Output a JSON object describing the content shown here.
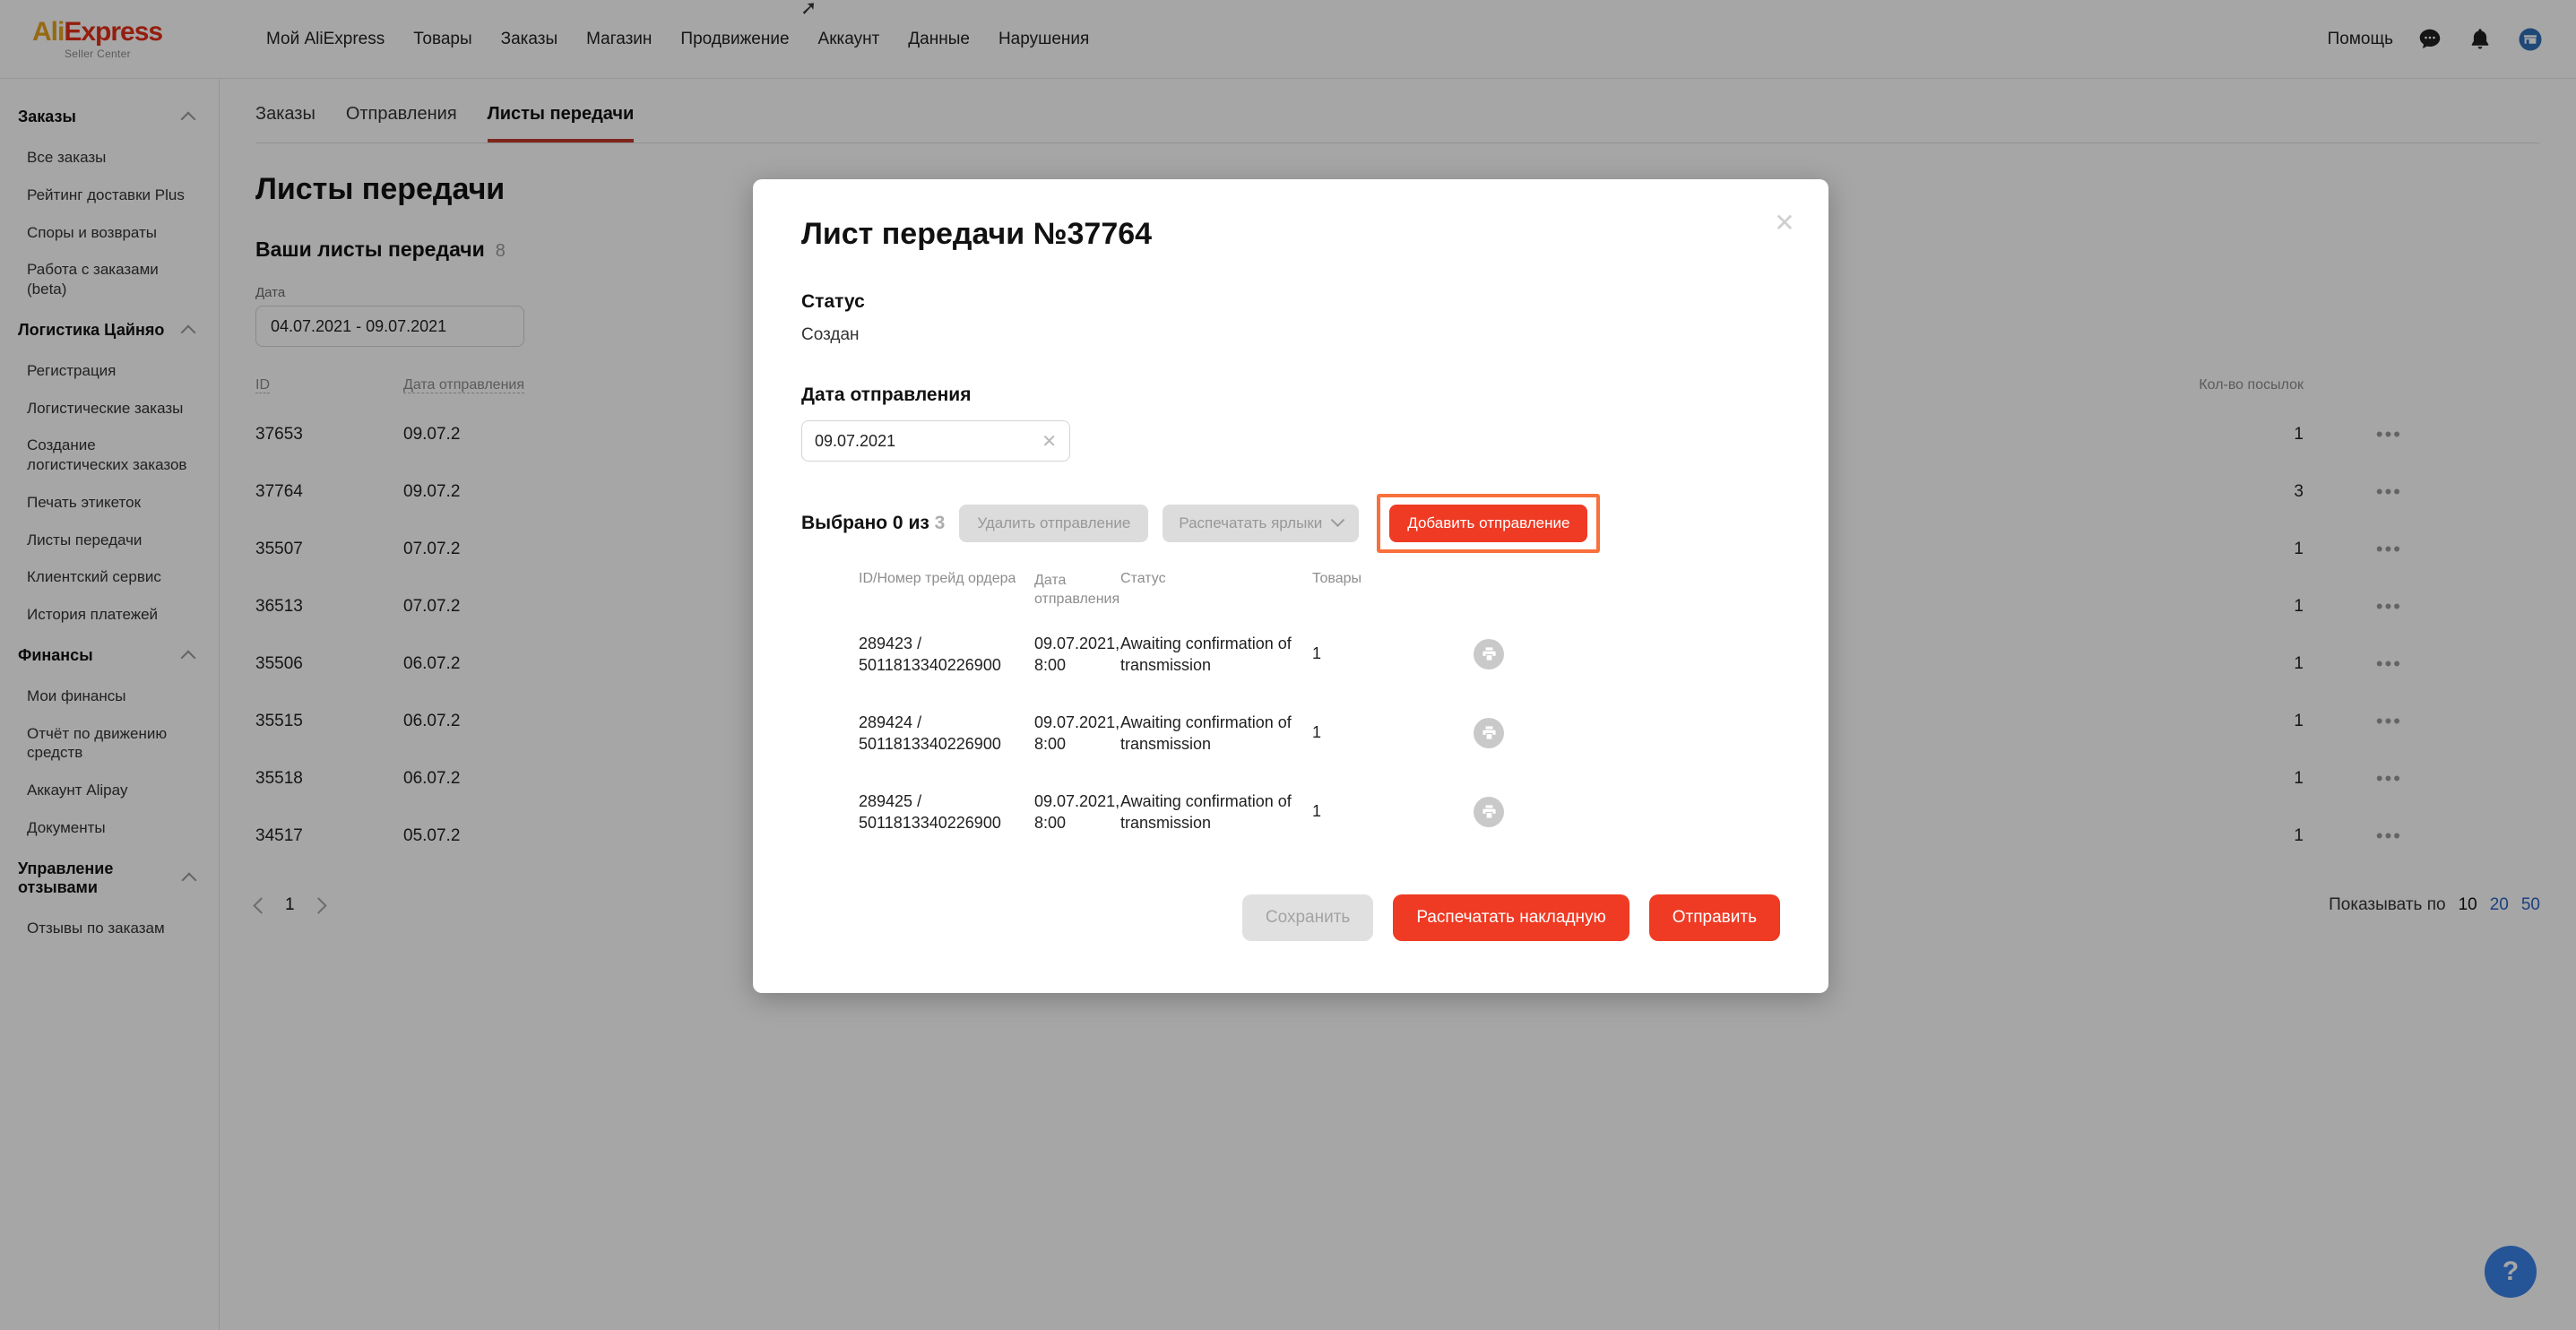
{
  "header": {
    "logo_main_first": "Ali",
    "logo_main_second": "Express",
    "logo_sub": "Seller Center",
    "nav": [
      "Мой AliExpress",
      "Товары",
      "Заказы",
      "Магазин",
      "Продвижение",
      "Аккаунт",
      "Данные",
      "Нарушения"
    ],
    "help_label": "Помощь",
    "icons": [
      "chat-bubble-icon",
      "bell-icon",
      "store-icon"
    ]
  },
  "sidebar": {
    "groups": [
      {
        "title": "Заказы",
        "items": [
          "Все заказы",
          "Рейтинг доставки Plus",
          "Споры и возвраты",
          "Работа с заказами (beta)"
        ]
      },
      {
        "title": "Логистика Цайняо",
        "items": [
          "Регистрация",
          "Логистические заказы",
          "Создание логистических заказов",
          "Печать этикеток",
          "Листы передачи",
          "Клиентский сервис",
          "История платежей"
        ]
      },
      {
        "title": "Финансы",
        "items": [
          "Мои финансы",
          "Отчёт по движению средств",
          "Аккаунт Alipay",
          "Документы"
        ]
      },
      {
        "title": "Управление отзывами",
        "items": [
          "Отзывы по заказам"
        ]
      }
    ]
  },
  "content": {
    "tabs": [
      {
        "label": "Заказы",
        "active": false
      },
      {
        "label": "Отправления",
        "active": false
      },
      {
        "label": "Листы передачи",
        "active": true
      }
    ],
    "page_title": "Листы передачи",
    "sub_title": "Ваши листы передачи",
    "sub_count": "8",
    "filter_label": "Дата",
    "date_range": "04.07.2021 - 09.07.2021",
    "table": {
      "headers": {
        "id": "ID",
        "date": "Дата отправления",
        "count": "Кол-во посылок",
        "actions": ""
      },
      "rows": [
        {
          "id": "37653",
          "date": "09.07.2",
          "count": "1",
          "actions": "•••"
        },
        {
          "id": "37764",
          "date": "09.07.2",
          "count": "3",
          "actions": "•••"
        },
        {
          "id": "35507",
          "date": "07.07.2",
          "count": "1",
          "actions": "•••"
        },
        {
          "id": "36513",
          "date": "07.07.2",
          "count": "1",
          "actions": "•••"
        },
        {
          "id": "35506",
          "date": "06.07.2",
          "count": "1",
          "actions": "•••"
        },
        {
          "id": "35515",
          "date": "06.07.2",
          "count": "1",
          "actions": "•••"
        },
        {
          "id": "35518",
          "date": "06.07.2",
          "count": "1",
          "actions": "•••"
        },
        {
          "id": "34517",
          "date": "05.07.2",
          "count": "1",
          "actions": "•••"
        }
      ]
    },
    "pagination": {
      "current_page": "1",
      "per_page_label": "Показывать по",
      "per_page_options": [
        {
          "value": "10",
          "selected": true
        },
        {
          "value": "20",
          "selected": false
        },
        {
          "value": "50",
          "selected": false
        }
      ]
    },
    "help_fab": "?"
  },
  "modal": {
    "title": "Лист передачи №37764",
    "close_icon": "✕",
    "status_label": "Статус",
    "status_value": "Создан",
    "ship_date_label": "Дата отправления",
    "ship_date_value": "09.07.2021",
    "ship_date_clear": "✕",
    "toolbar": {
      "selected_prefix": "Выбрано 0 из",
      "selected_total": "3",
      "delete_label": "Удалить отправление",
      "print_labels_label": "Распечатать ярлыки",
      "add_shipment_label": "Добавить отправление"
    },
    "table": {
      "headers": {
        "checkbox": "",
        "id": "ID/Номер трейд ордера",
        "date": "Дата отправления",
        "status": "Статус",
        "goods": "Товары",
        "print": ""
      },
      "rows": [
        {
          "id_line1": "289423 /",
          "id_line2": "5011813340226900",
          "date_line1": "09.07.2021,",
          "date_line2": "8:00",
          "status_line1": "Awaiting confirmation of",
          "status_line2": "transmission",
          "goods": "1"
        },
        {
          "id_line1": "289424 /",
          "id_line2": "5011813340226900",
          "date_line1": "09.07.2021,",
          "date_line2": "8:00",
          "status_line1": "Awaiting confirmation of",
          "status_line2": "transmission",
          "goods": "1"
        },
        {
          "id_line1": "289425 /",
          "id_line2": "5011813340226900",
          "date_line1": "09.07.2021,",
          "date_line2": "8:00",
          "status_line1": "Awaiting confirmation of",
          "status_line2": "transmission",
          "goods": "1"
        }
      ]
    },
    "footer": {
      "save_label": "Сохранить",
      "print_invoice_label": "Распечатать накладную",
      "send_label": "Отправить"
    }
  },
  "colors": {
    "brand_red": "#ef3a24",
    "highlight_orange": "#f8703c",
    "tab_underline": "#c0392b",
    "link_blue": "#2b63c4",
    "fab_blue": "#3981e8"
  }
}
